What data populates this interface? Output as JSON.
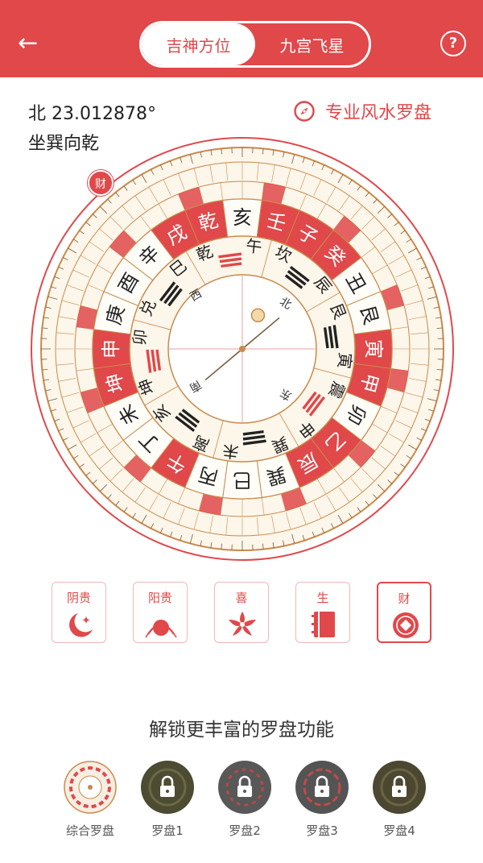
{
  "header": {
    "tabs": [
      {
        "label": "吉神方位",
        "active": true
      },
      {
        "label": "九宫飞星",
        "active": false
      }
    ],
    "back_icon": "arrow-left-icon",
    "help_icon": "question-circle-icon",
    "help_text": "?",
    "back_text": "←"
  },
  "info": {
    "latitude": "北 23.012878°",
    "facing": "坐巽向乾",
    "pro_link": "专业风水罗盘"
  },
  "compass": {
    "badge": "财",
    "center_labels": [
      "西",
      "北",
      "南",
      "东"
    ],
    "ring_mountains": [
      "戌",
      "乾",
      "亥",
      "壬",
      "子",
      "癸",
      "丑",
      "艮",
      "寅",
      "甲",
      "卯",
      "乙",
      "辰",
      "巽",
      "巳",
      "丙",
      "午",
      "丁",
      "未",
      "坤",
      "申",
      "庚",
      "酉",
      "辛"
    ],
    "highlight_mountains": [
      "戌",
      "乾",
      "壬",
      "子",
      "癸",
      "寅",
      "甲",
      "辰",
      "乙",
      "午",
      "申",
      "坤"
    ],
    "trigrams": [
      "乾",
      "坎",
      "艮",
      "震",
      "巽",
      "离",
      "坤",
      "兑"
    ],
    "trigram_branches": [
      "午",
      "辰",
      "寅",
      "申",
      "未",
      "亥",
      "卯",
      "巳"
    ],
    "colors": {
      "accent": "#e0484a",
      "wood": "#c98a4b",
      "ring_bg": "#fdf6ea"
    }
  },
  "gods": [
    {
      "label": "阴贵",
      "icon": "moon-star-icon",
      "selected": false
    },
    {
      "label": "阳贵",
      "icon": "sun-rise-icon",
      "selected": false
    },
    {
      "label": "喜",
      "icon": "flower-icon",
      "selected": false
    },
    {
      "label": "生",
      "icon": "book-icon",
      "selected": false
    },
    {
      "label": "财",
      "icon": "coin-icon",
      "selected": true
    }
  ],
  "unlock": {
    "title": "解锁更丰富的罗盘功能",
    "variants": [
      {
        "label": "综合罗盘",
        "locked": false,
        "icon": "compass-thumb-icon"
      },
      {
        "label": "罗盘1",
        "locked": true,
        "icon": "lock-icon"
      },
      {
        "label": "罗盘2",
        "locked": true,
        "icon": "lock-icon"
      },
      {
        "label": "罗盘3",
        "locked": true,
        "icon": "lock-icon"
      },
      {
        "label": "罗盘4",
        "locked": true,
        "icon": "lock-icon"
      }
    ]
  }
}
